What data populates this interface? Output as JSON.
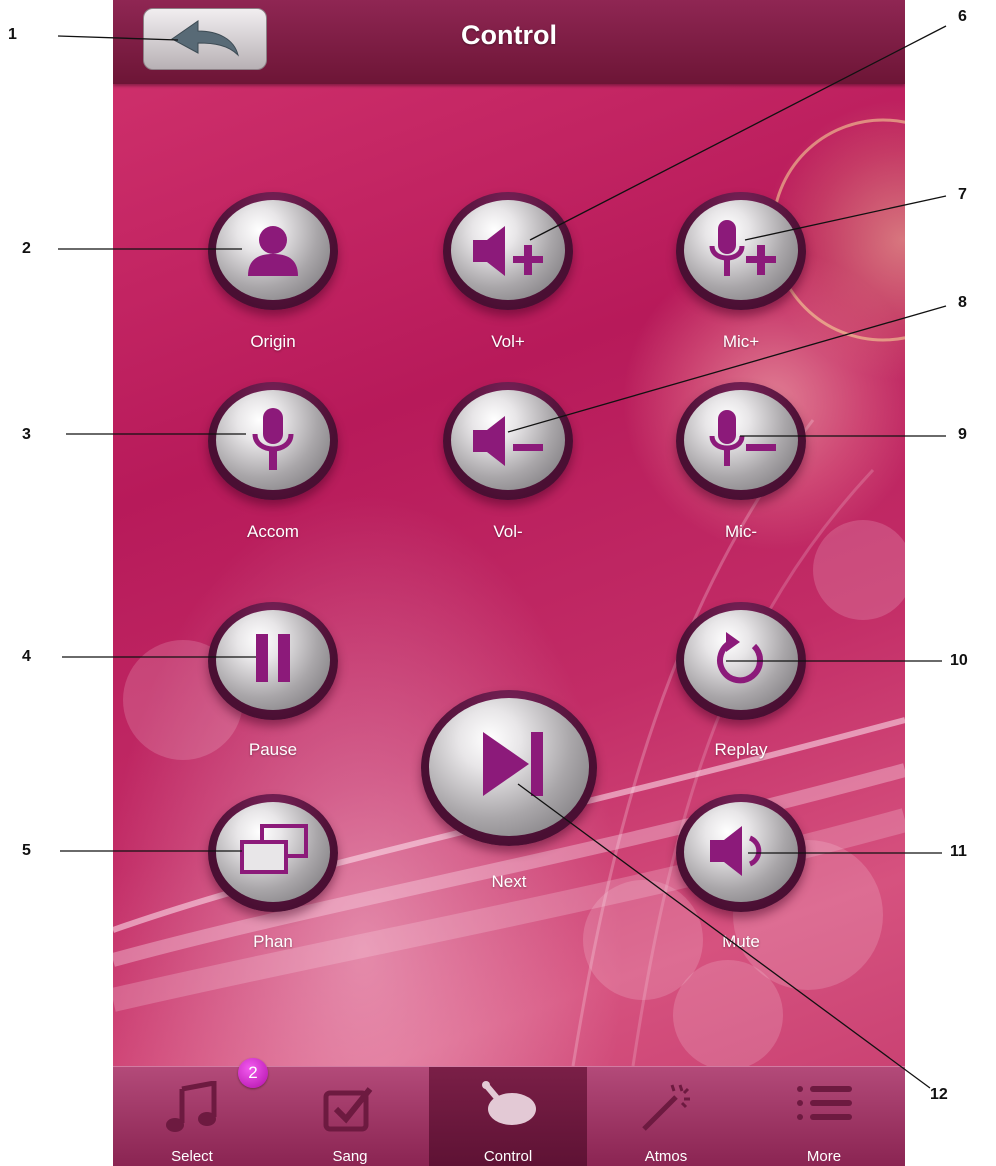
{
  "header": {
    "title": "Control",
    "back_icon": "back-arrow-icon"
  },
  "controls": [
    {
      "id": "origin",
      "label": "Origin",
      "icon": "person-icon"
    },
    {
      "id": "vol-up",
      "label": "Vol+",
      "icon": "volume-up-icon"
    },
    {
      "id": "mic-up",
      "label": "Mic+",
      "icon": "mic-up-icon"
    },
    {
      "id": "accom",
      "label": "Accom",
      "icon": "microphone-icon"
    },
    {
      "id": "vol-down",
      "label": "Vol-",
      "icon": "volume-down-icon"
    },
    {
      "id": "mic-down",
      "label": "Mic-",
      "icon": "mic-down-icon"
    },
    {
      "id": "pause",
      "label": "Pause",
      "icon": "pause-icon"
    },
    {
      "id": "replay",
      "label": "Replay",
      "icon": "replay-icon"
    },
    {
      "id": "next",
      "label": "Next",
      "icon": "next-track-icon"
    },
    {
      "id": "phan",
      "label": "Phan",
      "icon": "dual-screen-icon"
    },
    {
      "id": "mute",
      "label": "Mute",
      "icon": "mute-icon"
    }
  ],
  "tabbar": {
    "tabs": [
      {
        "label": "Select",
        "icon": "music-note-icon",
        "active": false
      },
      {
        "label": "Sang",
        "icon": "checklist-icon",
        "active": false,
        "badge": "2"
      },
      {
        "label": "Control",
        "icon": "control-icon",
        "active": true
      },
      {
        "label": "Atmos",
        "icon": "magic-wand-icon",
        "active": false
      },
      {
        "label": "More",
        "icon": "list-icon",
        "active": false
      }
    ]
  },
  "annotations": [
    "1",
    "2",
    "3",
    "4",
    "5",
    "6",
    "7",
    "8",
    "9",
    "10",
    "11",
    "12"
  ],
  "colors": {
    "accent": "#8c1a7a",
    "background": "#c0275f",
    "bar": "#8f2653"
  }
}
